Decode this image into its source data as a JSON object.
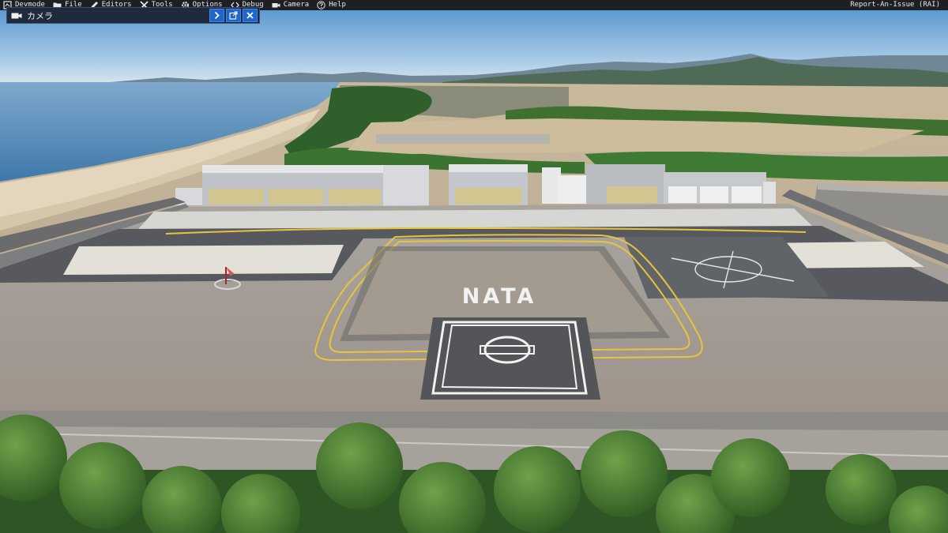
{
  "menubar": {
    "items": [
      {
        "label": "Devmode",
        "icon": "devmode-icon"
      },
      {
        "label": "File",
        "icon": "folder-icon"
      },
      {
        "label": "Editors",
        "icon": "pencil-icon"
      },
      {
        "label": "Tools",
        "icon": "tools-icon"
      },
      {
        "label": "Options",
        "icon": "gear-icon"
      },
      {
        "label": "Debug",
        "icon": "code-brackets-icon"
      },
      {
        "label": "Camera",
        "icon": "camera-icon"
      },
      {
        "label": "Help",
        "icon": "help-icon"
      }
    ],
    "report_label": "Report-An-Issue (RAI)"
  },
  "camera_panel": {
    "title": "カメラ",
    "icon": "video-camera-icon",
    "buttons": [
      {
        "icon": "chevron-right-icon"
      },
      {
        "icon": "popout-icon"
      },
      {
        "icon": "close-icon"
      }
    ]
  },
  "scene": {
    "ground_marking": "NATA",
    "colors": {
      "sky_top": "#5d9bd2",
      "sky_horizon": "#cfe0ee",
      "sea": "#5f8fb8",
      "apron": "#a39a90",
      "tarmac": "#54565c",
      "taxi_line": "#e8c43a",
      "marking": "#f2f2f2",
      "ui_panel": "#1f2a3c",
      "ui_button": "#1f66c9",
      "menubar": "#1d1f24"
    }
  }
}
